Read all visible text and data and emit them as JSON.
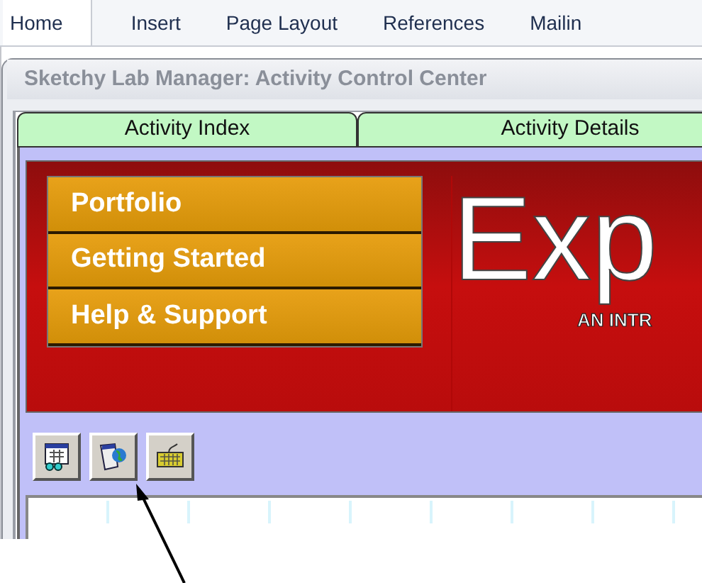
{
  "ribbon_tabs": [
    {
      "label": "Home",
      "selected": true
    },
    {
      "label": "Insert",
      "selected": false
    },
    {
      "label": "Page Layout",
      "selected": false
    },
    {
      "label": "References",
      "selected": false
    },
    {
      "label": "Mailin",
      "selected": false
    }
  ],
  "window": {
    "title": "Sketchy Lab Manager: Activity Control Center"
  },
  "tabs": [
    {
      "label": "Activity Index"
    },
    {
      "label": "Activity Details"
    }
  ],
  "banner": {
    "menu": [
      "Portfolio",
      "Getting Started",
      "Help & Support"
    ],
    "headline": "Exp",
    "subtitle": "AN INTR"
  },
  "toolbar": [
    {
      "kind": "calendar"
    },
    {
      "kind": "globe"
    },
    {
      "kind": "keyboard"
    }
  ]
}
